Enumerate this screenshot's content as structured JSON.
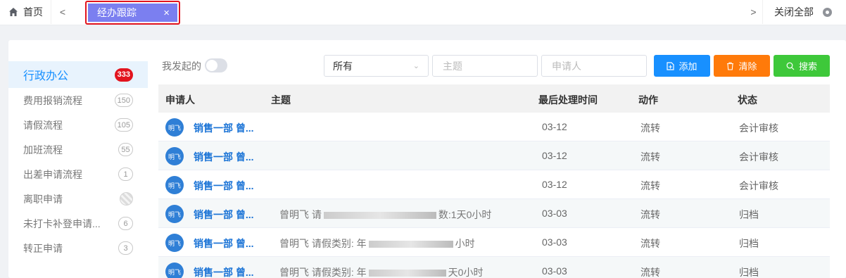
{
  "tabbar": {
    "home_label": "首页",
    "prev_glyph": "<",
    "active_tab_label": "经办跟踪",
    "active_tab_close": "×",
    "next_glyph": ">",
    "close_all_label": "关闭全部"
  },
  "sidebar": {
    "items": [
      {
        "label": "行政办公",
        "count": "333",
        "active": true
      },
      {
        "label": "费用报销流程",
        "count": "150"
      },
      {
        "label": "请假流程",
        "count": "105"
      },
      {
        "label": "加班流程",
        "count": "55"
      },
      {
        "label": "出差申请流程",
        "count": "1"
      },
      {
        "label": "离职申请",
        "count": ""
      },
      {
        "label": "未打卡补登申请...",
        "count": "6"
      },
      {
        "label": "转正申请",
        "count": "3"
      }
    ]
  },
  "toolbar": {
    "my_initiated_label": "我发起的",
    "select_value": "所有",
    "subject_placeholder": "主题",
    "applicant_placeholder": "申请人",
    "add_label": "添加",
    "clear_label": "清除",
    "search_label": "搜索",
    "add_color": "#1890ff",
    "clear_color": "#ff7a0a",
    "search_color": "#3ec83a"
  },
  "table": {
    "headers": {
      "applicant": "申请人",
      "subject": "主题",
      "last_time": "最后处理时间",
      "action": "动作",
      "status": "状态"
    },
    "rows": [
      {
        "avatar": "明飞",
        "name": "销售一部 曾...",
        "subject_a": "",
        "subject_b": "",
        "time": "03-12",
        "action": "流转",
        "status": "会计审核"
      },
      {
        "avatar": "明飞",
        "name": "销售一部 曾...",
        "subject_a": "",
        "subject_b": "",
        "time": "03-12",
        "action": "流转",
        "status": "会计审核"
      },
      {
        "avatar": "明飞",
        "name": "销售一部 曾...",
        "subject_a": "",
        "subject_b": "",
        "time": "03-12",
        "action": "流转",
        "status": "会计审核"
      },
      {
        "avatar": "明飞",
        "name": "销售一部 曾...",
        "subject_a": "曾明飞 请",
        "subject_b": "数:1天0小时",
        "time": "03-03",
        "action": "流转",
        "status": "归档"
      },
      {
        "avatar": "明飞",
        "name": "销售一部 曾...",
        "subject_a": "曾明飞 请假类别: 年",
        "subject_b": "小时",
        "time": "03-03",
        "action": "流转",
        "status": "归档"
      },
      {
        "avatar": "明飞",
        "name": "销售一部 曾...",
        "subject_a": "曾明飞 请假类别: 年",
        "subject_b": "天0小时",
        "time": "03-03",
        "action": "流转",
        "status": "归档"
      }
    ]
  },
  "icons": {
    "home": "home-icon",
    "settings": "gear-icon",
    "add": "document-add-icon",
    "clear": "trash-icon",
    "search": "search-icon"
  }
}
